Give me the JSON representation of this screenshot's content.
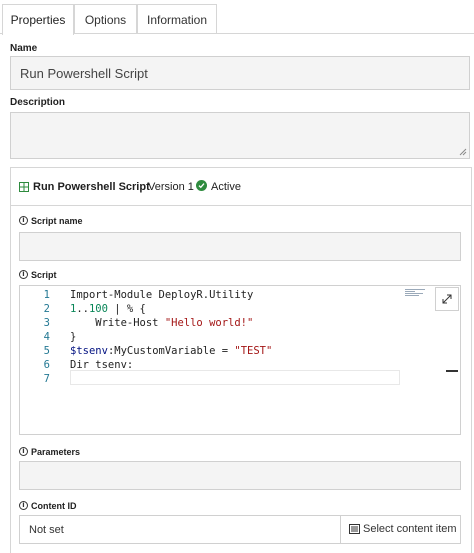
{
  "tabs": [
    {
      "label": "Properties"
    },
    {
      "label": "Options"
    },
    {
      "label": "Information"
    }
  ],
  "name": {
    "label": "Name",
    "value": "Run Powershell Script"
  },
  "description": {
    "label": "Description",
    "value": ""
  },
  "step": {
    "title": "Run Powershell Script",
    "version": "Version 1",
    "status": "Active"
  },
  "script_name": {
    "label": "Script name",
    "value": ""
  },
  "script": {
    "label": "Script",
    "line_numbers": [
      "1",
      "2",
      "3",
      "4",
      "5",
      "6",
      "7"
    ],
    "lines": [
      {
        "t1": "Import-Module DeployR.Utility"
      },
      {
        "n1": "1",
        "t1": "..",
        "n2": "100",
        "t2": " | % {"
      },
      {
        "t1": "    Write-Host ",
        "s1": "\"Hello world!\""
      },
      {
        "t1": "}"
      },
      {
        "v1": "$tsenv",
        "t1": ":MyCustomVariable = ",
        "s1": "\"TEST\""
      },
      {
        "t1": "Dir tsenv:"
      },
      {
        "t1": ""
      }
    ]
  },
  "parameters": {
    "label": "Parameters",
    "value": ""
  },
  "content_id": {
    "label": "Content ID",
    "value": "Not set",
    "button": "Select content item"
  },
  "colors": {
    "active_green": "#2e8b3e",
    "string_red": "#a31515",
    "line_number": "#237893"
  }
}
